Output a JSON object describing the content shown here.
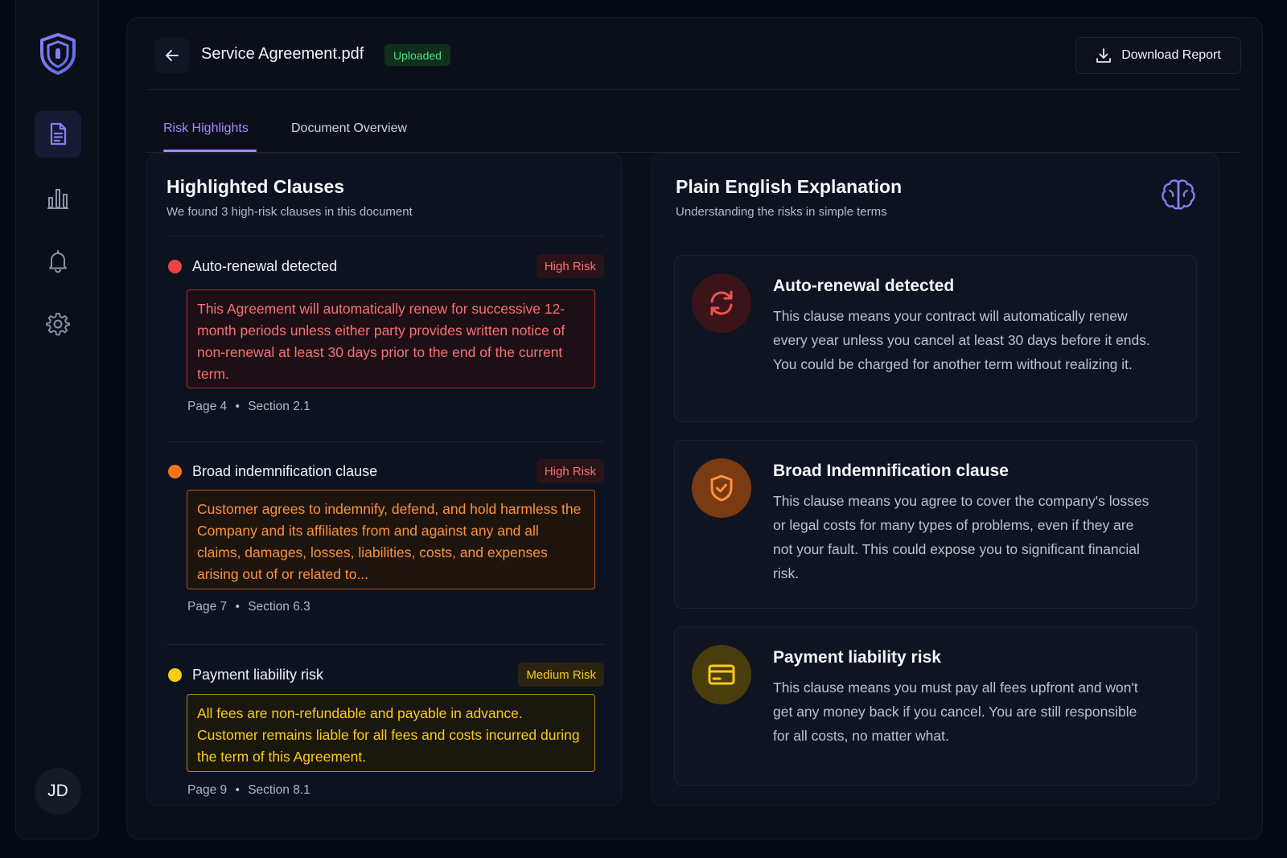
{
  "document": {
    "filename": "Service Agreement.pdf",
    "status": "Uploaded",
    "download_label": "Download Report"
  },
  "tabs": [
    {
      "label": "Risk Highlights",
      "active": true
    },
    {
      "label": "Document Overview",
      "active": false
    }
  ],
  "user": {
    "initials": "JD"
  },
  "highlighted": {
    "title": "Highlighted Clauses",
    "subtitle": "We found 3 high-risk clauses in this document",
    "clauses": [
      {
        "title": "Auto-renewal detected",
        "risk": "High Risk",
        "excerpt": "This Agreement will automatically renew for successive 12-month periods unless either party provides written notice of non-renewal at least 30 days prior to the end of the current term.",
        "page": "Page 4",
        "section": "Section 2.1",
        "color": "#ef4444"
      },
      {
        "title": "Broad indemnification clause",
        "risk": "High Risk",
        "excerpt": "Customer agrees to indemnify, defend, and hold harmless the Company and its affiliates from and against any and all claims, damages, losses, liabilities, costs, and expenses arising out of or related to...",
        "page": "Page 7",
        "section": "Section 6.3",
        "color": "#f97316"
      },
      {
        "title": "Payment liability risk",
        "risk": "Medium Risk",
        "excerpt": "All fees are non-refundable and payable in advance. Customer remains liable for all fees and costs incurred during the term of this Agreement.",
        "page": "Page 9",
        "section": "Section 8.1",
        "color": "#facc15"
      }
    ]
  },
  "explanation": {
    "title": "Plain English Explanation",
    "subtitle": "Understanding the risks in simple terms",
    "cards": [
      {
        "title": "Auto-renewal detected",
        "text": "This clause means your contract will automatically renew every year unless you cancel at least 30 days before it ends. You could be charged for another term without realizing it.",
        "icon": "refresh-icon"
      },
      {
        "title": "Broad Indemnification clause",
        "text": "This clause means you agree to cover the company's losses or legal costs for many types of problems, even if they are not your fault. This could expose you to significant financial risk.",
        "icon": "shield-check-icon"
      },
      {
        "title": "Payment liability risk",
        "text": "This clause means you must pay all fees upfront and won't get any money back if you cancel. You are still responsible for all costs, no matter what.",
        "icon": "credit-card-icon"
      }
    ]
  }
}
